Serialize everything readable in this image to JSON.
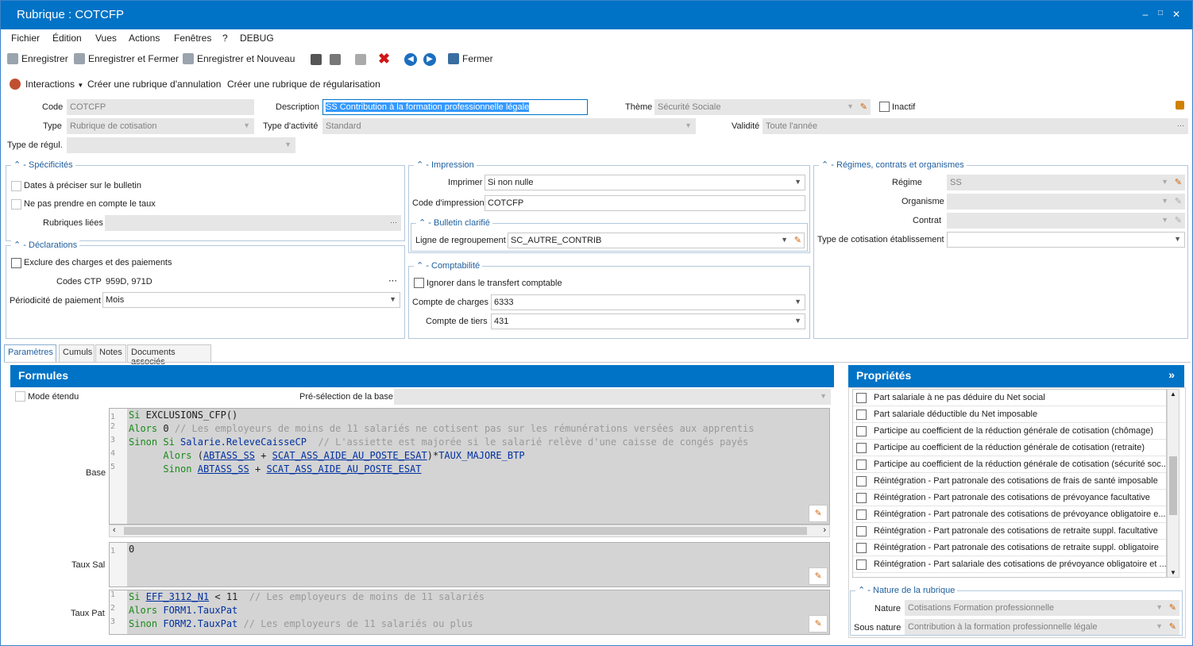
{
  "window": {
    "title": "Rubrique : COTCFP"
  },
  "menu": [
    "Fichier",
    "Édition",
    "Vues",
    "Actions",
    "Fenêtres",
    "?",
    "DEBUG"
  ],
  "toolbar": {
    "save": "Enregistrer",
    "save_close": "Enregistrer et Fermer",
    "save_new": "Enregistrer et Nouveau",
    "close": "Fermer"
  },
  "actions": {
    "interactions": "Interactions",
    "cancel": "Créer une rubrique d'annulation",
    "regul": "Créer une rubrique de régularisation"
  },
  "form": {
    "code_label": "Code",
    "code": "COTCFP",
    "desc_label": "Description",
    "desc": "SS Contribution à la formation professionnelle légale",
    "theme_label": "Thème",
    "theme": "Sécurité Sociale",
    "inactive_label": "Inactif",
    "type_label": "Type",
    "type": "Rubrique de cotisation",
    "activity_label": "Type d'activité",
    "activity": "Standard",
    "validity_label": "Validité",
    "validity": "Toute l'année",
    "regul_label": "Type de régul."
  },
  "specs": {
    "title": "Spécificités",
    "dates": "Dates à préciser sur le bulletin",
    "no_rate": "Ne pas prendre en compte le taux",
    "linked_label": "Rubriques liées"
  },
  "decl": {
    "title": "Déclarations",
    "exclude": "Exclure des charges et des paiements",
    "ctp_label": "Codes CTP",
    "ctp": "959D, 971D",
    "period_label": "Périodicité de paiement",
    "period": "Mois"
  },
  "print": {
    "title": "Impression",
    "print_label": "Imprimer",
    "print": "Si non nulle",
    "code_label": "Code d'impression",
    "code": "COTCFP"
  },
  "bulletin": {
    "title": "Bulletin clarifié",
    "line_label": "Ligne de regroupement",
    "line": "SC_AUTRE_CONTRIB"
  },
  "compta": {
    "title": "Comptabilité",
    "ignore": "Ignorer dans le transfert comptable",
    "charges_label": "Compte de charges",
    "charges": "6333",
    "tiers_label": "Compte de tiers",
    "tiers": "431"
  },
  "regimes": {
    "title": "Régimes, contrats et organismes",
    "regime_label": "Régime",
    "regime": "SS",
    "org_label": "Organisme",
    "contract_label": "Contrat",
    "etab_label": "Type de cotisation établissement"
  },
  "tabs": [
    "Paramètres",
    "Cumuls",
    "Notes",
    "Documents associés"
  ],
  "formulas": {
    "title": "Formules",
    "extended": "Mode étendu",
    "preselect": "Pré-sélection de la base",
    "base_label": "Base",
    "tsal_label": "Taux Sal",
    "tpat_label": "Taux Pat",
    "base_lines": [
      "1",
      "2",
      "3",
      "4",
      "5"
    ],
    "tsal_value": "0"
  },
  "props": {
    "title": "Propriétés",
    "items": [
      "Part salariale à ne pas déduire du Net social",
      "Part salariale déductible du Net imposable",
      "Participe au coefficient de la réduction générale de cotisation (chômage)",
      "Participe au coefficient de la réduction générale de cotisation (retraite)",
      "Participe au coefficient de la réduction générale de cotisation (sécurité soc...",
      "Réintégration - Part patronale des cotisations de frais de santé imposable",
      "Réintégration - Part patronale des cotisations de prévoyance facultative",
      "Réintégration - Part patronale des cotisations de prévoyance obligatoire e...",
      "Réintégration - Part patronale des cotisations de retraite suppl. facultative",
      "Réintégration - Part patronale des cotisations de retraite suppl. obligatoire",
      "Réintégration - Part salariale des cotisations de prévoyance obligatoire et ..."
    ]
  },
  "nature": {
    "title": "Nature de la rubrique",
    "nature_label": "Nature",
    "nature": "Cotisations Formation professionnelle",
    "sub_label": "Sous nature",
    "sub": "Contribution à la formation professionnelle légale"
  }
}
